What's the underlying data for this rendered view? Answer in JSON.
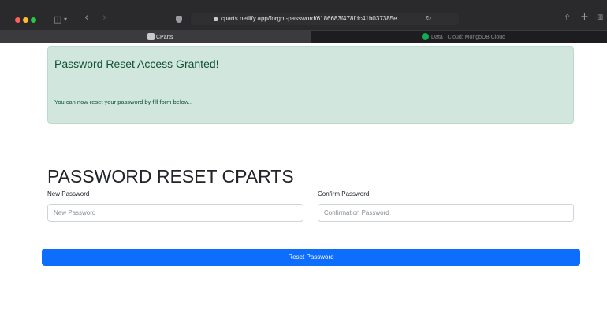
{
  "browser": {
    "url": "cparts.netlify.app/forgot-password/6186683f478fdc41b037385e",
    "tabs": [
      {
        "label": "CParts",
        "active": true
      },
      {
        "label": "Data | Cloud: MongoDB Cloud",
        "active": false
      }
    ]
  },
  "alert": {
    "title": "Password Reset Access Granted!",
    "message": "You can now reset your password by fill form below.."
  },
  "form": {
    "heading": "PASSWORD RESET CPARTS",
    "new_password_label": "New Password",
    "new_password_placeholder": "New Password",
    "confirm_password_label": "Confirm Password",
    "confirm_password_placeholder": "Confirmation Password",
    "submit_label": "Reset Password"
  },
  "colors": {
    "alert_bg": "#d1e7dd",
    "alert_text": "#0f5132",
    "button_primary": "#0d6efd",
    "titlebar": "#2a2a2c"
  },
  "icons": [
    "sidebar-icon",
    "back-icon",
    "forward-icon",
    "shield-icon",
    "lock-icon",
    "reload-icon",
    "share-icon",
    "new-tab-icon",
    "tab-overview-icon"
  ]
}
